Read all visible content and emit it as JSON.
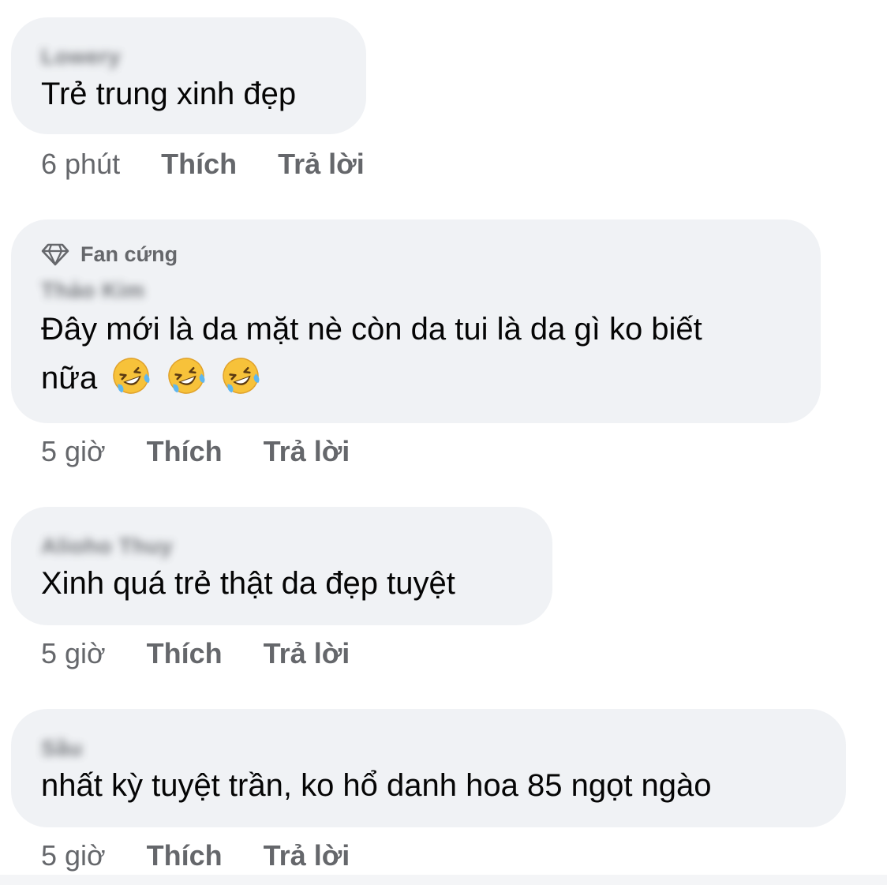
{
  "comments": [
    {
      "author": "Lowery",
      "badge": "",
      "lines": [
        "Trẻ trung xinh đẹp"
      ],
      "time": "6 phút",
      "like": "Thích",
      "reply": "Trả lời"
    },
    {
      "author": "Thảo Kim",
      "badge": "Fan cứng",
      "lines": [
        "Đây mới là da mặt nè còn da tui là da gì ko biết",
        "nữa"
      ],
      "emojis": [
        "rolling-on-floor-laughing",
        "rolling-on-floor-laughing",
        "rolling-on-floor-laughing"
      ],
      "time": "5 giờ",
      "like": "Thích",
      "reply": "Trả lời"
    },
    {
      "author": "Alioho Thuy",
      "badge": "",
      "lines": [
        "Xinh quá trẻ thật da đẹp tuyệt"
      ],
      "time": "5 giờ",
      "like": "Thích",
      "reply": "Trả lời"
    },
    {
      "author": "Sầu",
      "badge": "",
      "lines": [
        "nhất kỳ tuyệt trần, ko hổ danh hoa 85 ngọt ngào"
      ],
      "time": "5 giờ",
      "like": "Thích",
      "reply": "Trả lời"
    }
  ],
  "colors": {
    "bubble_bg": "#f0f2f5",
    "text": "#050505",
    "secondary": "#65676b"
  },
  "icons": {
    "badge": "diamond-icon",
    "emoji": "rolling-on-floor-laughing"
  }
}
